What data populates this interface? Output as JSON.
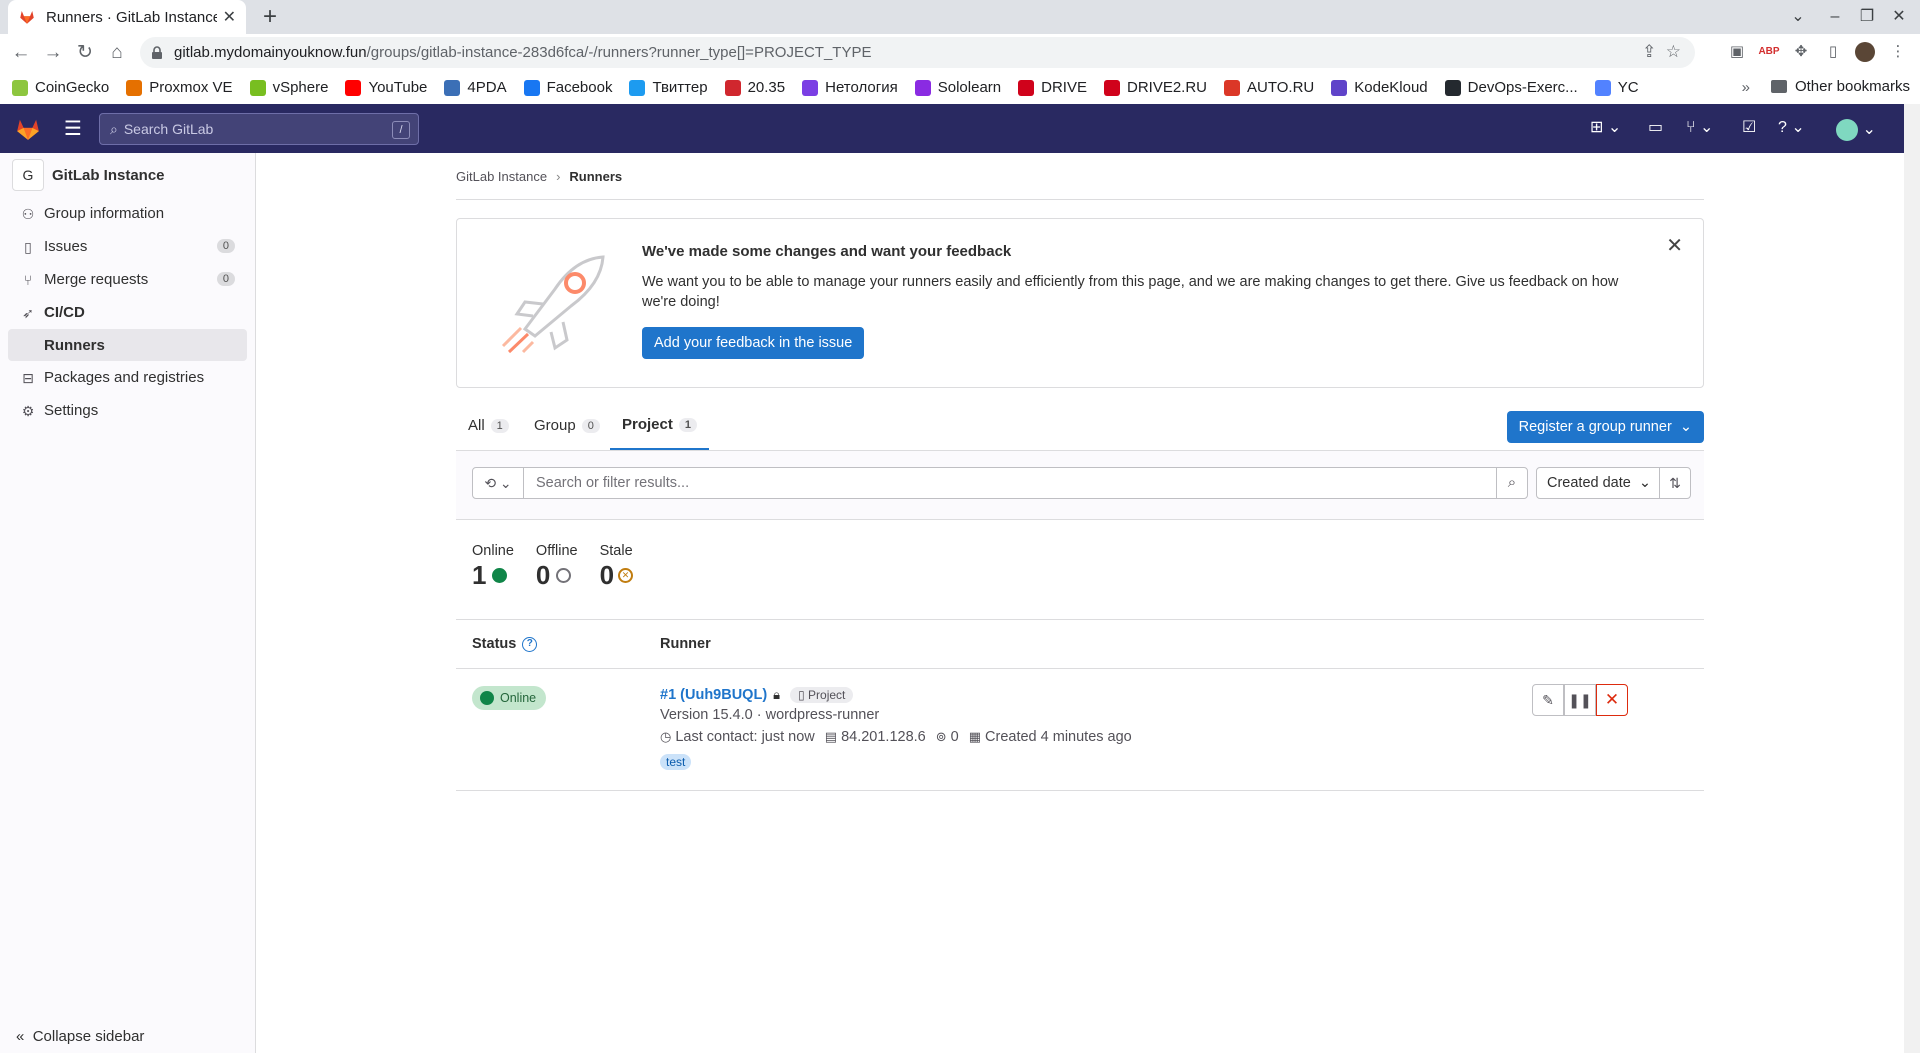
{
  "browser": {
    "tab_title": "Runners · GitLab Instance",
    "url_host": "gitlab.mydomainyouknow.fun",
    "url_path": "/groups/gitlab-instance-283d6fca/-/runners?runner_type[]=PROJECT_TYPE",
    "bookmarks": [
      {
        "label": "CoinGecko",
        "icon": "coingecko-icon",
        "color": "#8dc63f"
      },
      {
        "label": "Proxmox VE",
        "icon": "proxmox-icon",
        "color": "#e57000"
      },
      {
        "label": "vSphere",
        "icon": "vsphere-icon",
        "color": "#78be20"
      },
      {
        "label": "YouTube",
        "icon": "youtube-icon",
        "color": "#ff0000"
      },
      {
        "label": "4PDA",
        "icon": "4pda-icon",
        "color": "#3b6fb6"
      },
      {
        "label": "Facebook",
        "icon": "facebook-icon",
        "color": "#1877f2"
      },
      {
        "label": "Твиттер",
        "icon": "twitter-icon",
        "color": "#1d9bf0"
      },
      {
        "label": "20.35",
        "icon": "2035-icon",
        "color": "#d0272e"
      },
      {
        "label": "Нетология",
        "icon": "netology-icon",
        "color": "#7b3fe4"
      },
      {
        "label": "Sololearn",
        "icon": "sololearn-icon",
        "color": "#8a2be2"
      },
      {
        "label": "DRIVE",
        "icon": "drive-icon",
        "color": "#d0021b"
      },
      {
        "label": "DRIVE2.RU",
        "icon": "drive2-icon",
        "color": "#d0021b"
      },
      {
        "label": "AUTO.RU",
        "icon": "autoru-icon",
        "color": "#db3727"
      },
      {
        "label": "KodeKloud",
        "icon": "kodekloud-icon",
        "color": "#5f43c9"
      },
      {
        "label": "DevOps-Exerc...",
        "icon": "github-icon",
        "color": "#24292f"
      },
      {
        "label": "YC",
        "icon": "yc-icon",
        "color": "#5282ff"
      }
    ],
    "other_bookmarks": "Other bookmarks"
  },
  "topbar": {
    "search_placeholder": "Search GitLab",
    "search_shortcut": "/"
  },
  "sidebar": {
    "group_avatar": "G",
    "group_name": "GitLab Instance",
    "items": [
      {
        "label": "Group information",
        "icon": "group-icon"
      },
      {
        "label": "Issues",
        "icon": "issues-icon",
        "count": "0"
      },
      {
        "label": "Merge requests",
        "icon": "merge-request-icon",
        "count": "0"
      },
      {
        "label": "CI/CD",
        "icon": "rocket-icon"
      },
      {
        "label": "Packages and registries",
        "icon": "package-icon"
      },
      {
        "label": "Settings",
        "icon": "settings-icon"
      }
    ],
    "sub_item": "Runners",
    "collapse": "Collapse sidebar"
  },
  "breadcrumb": {
    "parent": "GitLab Instance",
    "current": "Runners"
  },
  "banner": {
    "title": "We've made some changes and want your feedback",
    "body": "We want you to be able to manage your runners easily and efficiently from this page, and we are making changes to get there. Give us feedback on how we're doing!",
    "button": "Add your feedback in the issue"
  },
  "tabs": [
    {
      "label": "All",
      "count": "1"
    },
    {
      "label": "Group",
      "count": "0"
    },
    {
      "label": "Project",
      "count": "1"
    }
  ],
  "register_button": "Register a group runner",
  "filter": {
    "placeholder": "Search or filter results...",
    "sort_label": "Created date"
  },
  "stats": [
    {
      "label": "Online",
      "value": "1",
      "color": "#108548"
    },
    {
      "label": "Offline",
      "value": "0",
      "color": "#737278"
    },
    {
      "label": "Stale",
      "value": "0",
      "color": "#c17d10"
    }
  ],
  "table": {
    "col_status": "Status",
    "col_runner": "Runner"
  },
  "runner": {
    "status": "Online",
    "name": "#1 (Uuh9BUQL)",
    "type_badge": "Project",
    "version": "Version 15.4.0 · wordpress-runner",
    "last_contact": "Last contact: just now",
    "ip": "84.201.128.6",
    "jobs": "0",
    "created": "Created 4 minutes ago",
    "tag": "test"
  },
  "colors": {
    "gitlab_nav": "#292961",
    "primary": "#1f75cb",
    "danger": "#dd2b0e"
  }
}
